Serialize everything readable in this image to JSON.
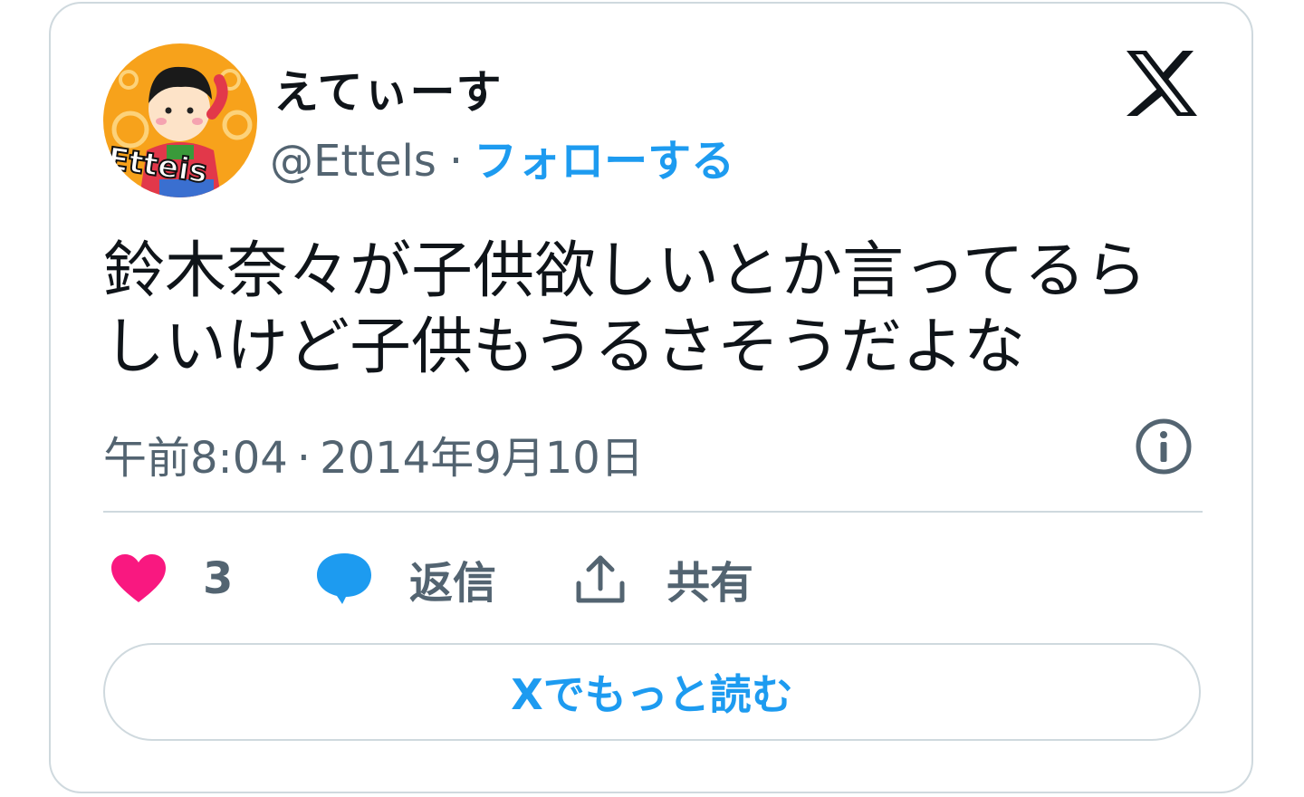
{
  "user": {
    "display_name": "えてぃーす",
    "handle": "@Ettels",
    "separator": "·",
    "follow_label": "フォローする",
    "avatar_text": "Etteis"
  },
  "tweet": {
    "text": "鈴木奈々が子供欲しいとか言ってるらしいけど子供もうるさそうだよな",
    "time": "午前8:04",
    "date": "2014年9月10日",
    "separator": "·"
  },
  "actions": {
    "like_count": "3",
    "reply_label": "返信",
    "share_label": "共有"
  },
  "read_more_label": "Xでもっと読む",
  "icons": {
    "logo": "x-logo-icon",
    "info": "info-icon",
    "like": "heart-icon",
    "reply": "speech-bubble-icon",
    "share": "share-upload-icon"
  },
  "colors": {
    "accent": "#1d9bf0",
    "like": "#f91880",
    "text": "#0f1419",
    "secondary": "#536471",
    "border": "#cfd9de"
  }
}
